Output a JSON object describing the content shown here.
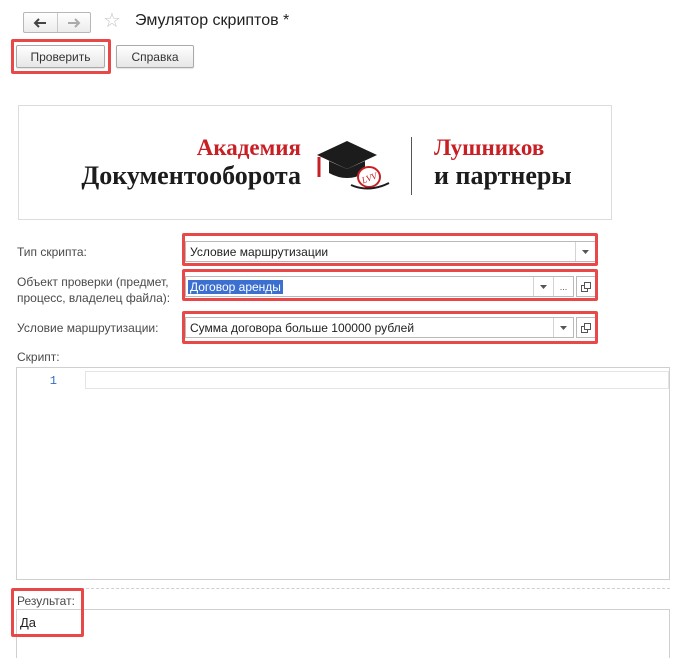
{
  "window": {
    "title": "Эмулятор скриптов *",
    "icons": {
      "back": "arrow-left-icon",
      "forward": "arrow-right-icon",
      "favorite": "star-icon"
    }
  },
  "toolbar": {
    "check_label": "Проверить",
    "help_label": "Справка"
  },
  "logo": {
    "left_top": "Академия",
    "left_bottom": "Документооборота",
    "right_top": "Лушников",
    "right_bottom": "и партнеры",
    "mark_text": "LVV",
    "colors": {
      "red": "#c81f24",
      "dark": "#1c1c1c"
    }
  },
  "form": {
    "script_type": {
      "label": "Тип скрипта:",
      "value": "Условие маршрутизации"
    },
    "check_object": {
      "label_line1": "Объект проверки (предмет,",
      "label_line2": "процесс, владелец файла):",
      "value": "Договор аренды",
      "select_button": "..."
    },
    "routing_condition": {
      "label": "Условие маршрутизации:",
      "value": "Сумма договора больше 100000 рублей"
    },
    "script": {
      "label": "Скрипт:",
      "line_number": "1"
    },
    "result": {
      "label": "Результат:",
      "value": "Да"
    }
  },
  "colors": {
    "highlight": "#e84848",
    "selection": "#3b6fd0",
    "line_number": "#2f6fc3"
  }
}
